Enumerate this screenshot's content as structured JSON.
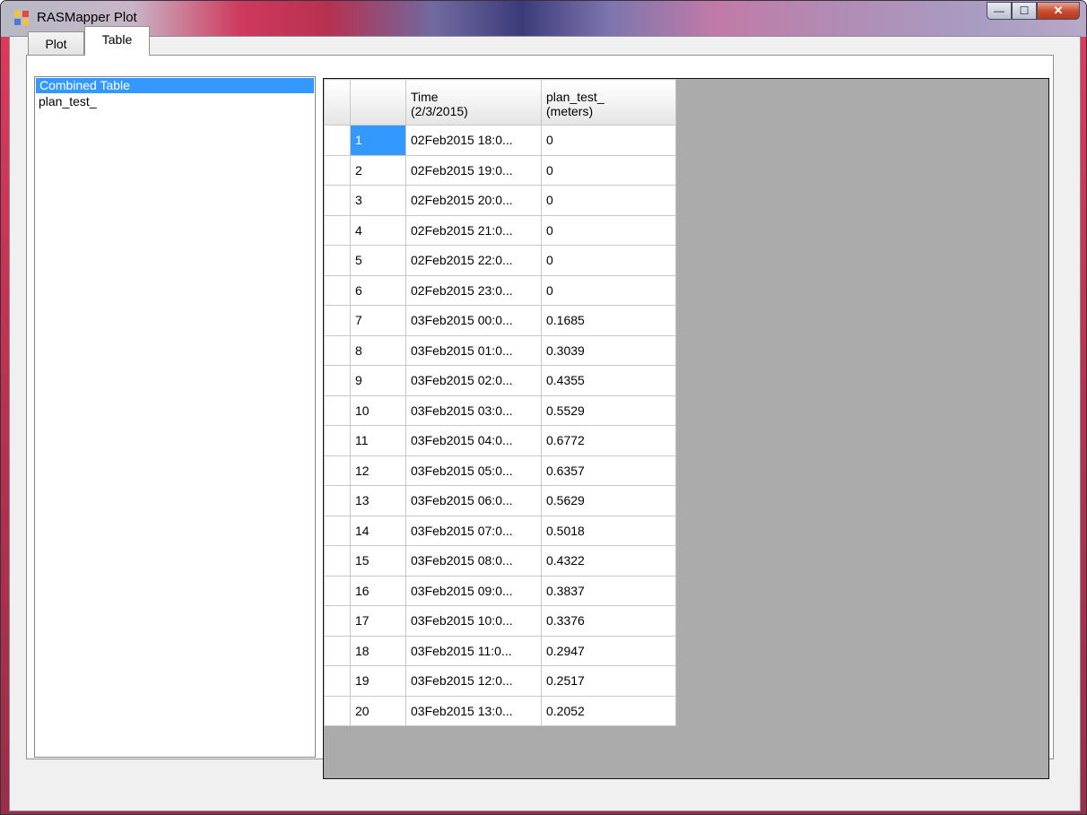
{
  "window": {
    "title": "RASMapper Plot",
    "controls": {
      "minimize": "—",
      "maximize": "☐",
      "close": "✕"
    }
  },
  "tabs": [
    {
      "label": "Plot"
    },
    {
      "label": "Table"
    }
  ],
  "list": {
    "items": [
      "Combined Table",
      "plan_test_"
    ],
    "selected_index": 0
  },
  "grid": {
    "columns": [
      {
        "line1": "",
        "line2": ""
      },
      {
        "line1": "Time",
        "line2": "(2/3/2015)"
      },
      {
        "line1": "plan_test_",
        "line2": "(meters)"
      }
    ],
    "rows": [
      {
        "n": "1",
        "time": "02Feb2015 18:0...",
        "value": "0"
      },
      {
        "n": "2",
        "time": "02Feb2015 19:0...",
        "value": "0"
      },
      {
        "n": "3",
        "time": "02Feb2015 20:0...",
        "value": "0"
      },
      {
        "n": "4",
        "time": "02Feb2015 21:0...",
        "value": "0"
      },
      {
        "n": "5",
        "time": "02Feb2015 22:0...",
        "value": "0"
      },
      {
        "n": "6",
        "time": "02Feb2015 23:0...",
        "value": "0"
      },
      {
        "n": "7",
        "time": "03Feb2015 00:0...",
        "value": "0.1685"
      },
      {
        "n": "8",
        "time": "03Feb2015 01:0...",
        "value": "0.3039"
      },
      {
        "n": "9",
        "time": "03Feb2015 02:0...",
        "value": "0.4355"
      },
      {
        "n": "10",
        "time": "03Feb2015 03:0...",
        "value": "0.5529"
      },
      {
        "n": "11",
        "time": "03Feb2015 04:0...",
        "value": "0.6772"
      },
      {
        "n": "12",
        "time": "03Feb2015 05:0...",
        "value": "0.6357"
      },
      {
        "n": "13",
        "time": "03Feb2015 06:0...",
        "value": "0.5629"
      },
      {
        "n": "14",
        "time": "03Feb2015 07:0...",
        "value": "0.5018"
      },
      {
        "n": "15",
        "time": "03Feb2015 08:0...",
        "value": "0.4322"
      },
      {
        "n": "16",
        "time": "03Feb2015 09:0...",
        "value": "0.3837"
      },
      {
        "n": "17",
        "time": "03Feb2015 10:0...",
        "value": "0.3376"
      },
      {
        "n": "18",
        "time": "03Feb2015 11:0...",
        "value": "0.2947"
      },
      {
        "n": "19",
        "time": "03Feb2015 12:0...",
        "value": "0.2517"
      },
      {
        "n": "20",
        "time": "03Feb2015 13:0...",
        "value": "0.2052"
      }
    ]
  },
  "colors": {
    "selection": "#3399ff",
    "grid_background": "#ababab"
  }
}
